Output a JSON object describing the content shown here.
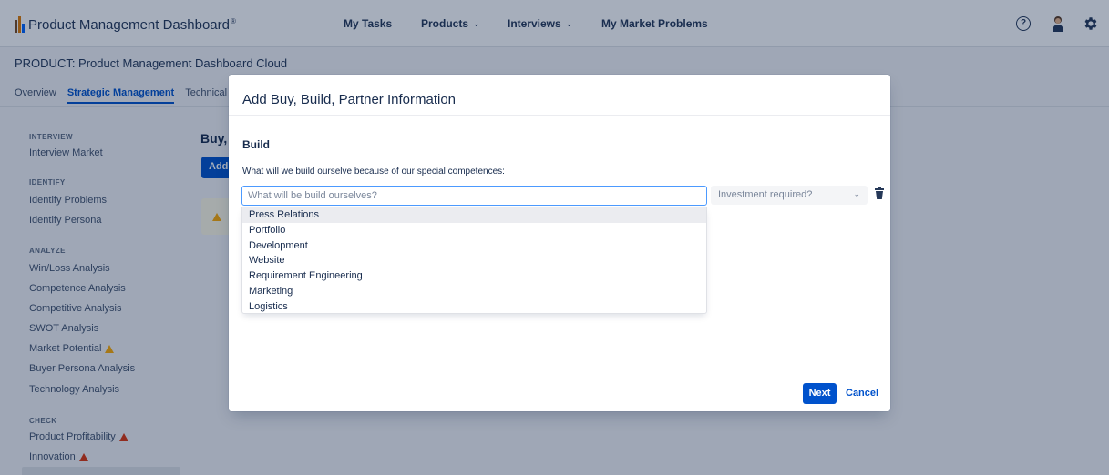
{
  "header": {
    "app_title": "Product Management Dashboard",
    "registered_mark": "®",
    "nav": [
      {
        "label": "My Tasks",
        "has_dropdown": false
      },
      {
        "label": "Products",
        "has_dropdown": true
      },
      {
        "label": "Interviews",
        "has_dropdown": true
      },
      {
        "label": "My Market Problems",
        "has_dropdown": false
      }
    ],
    "help_glyph": "?",
    "icons": [
      "help-icon",
      "user-avatar-icon",
      "settings-gear-icon"
    ]
  },
  "breadcrumb": "PRODUCT: Product Management Dashboard Cloud",
  "tabs": [
    "Overview",
    "Strategic Management",
    "Technical"
  ],
  "active_tab": "Strategic Management",
  "sidebar": {
    "sections": [
      {
        "title": "INTERVIEW",
        "items": [
          {
            "label": "Interview Market",
            "status": null
          }
        ]
      },
      {
        "title": "IDENTIFY",
        "items": [
          {
            "label": "Identify Problems",
            "status": null
          },
          {
            "label": "Identify Persona",
            "status": null
          }
        ]
      },
      {
        "title": "ANALYZE",
        "items": [
          {
            "label": "Win/Loss Analysis",
            "status": null
          },
          {
            "label": "Competence Analysis",
            "status": null
          },
          {
            "label": "Competitive Analysis",
            "status": null
          },
          {
            "label": "SWOT Analysis",
            "status": null
          },
          {
            "label": "Market Potential",
            "status": "warning-yellow"
          },
          {
            "label": "Buyer Persona Analysis",
            "status": null
          },
          {
            "label": "Technology Analysis",
            "status": null
          }
        ]
      },
      {
        "title": "CHECK",
        "items": [
          {
            "label": "Product Profitability",
            "status": "warning-red"
          },
          {
            "label": "Innovation",
            "status": "warning-red"
          }
        ]
      }
    ]
  },
  "main": {
    "heading": "Buy, I",
    "add_label": "Add"
  },
  "modal": {
    "title": "Add Buy, Build, Partner Information",
    "section_title": "Build",
    "field_label": "What will we build ourselve because of our special competences:",
    "input": {
      "value": "",
      "placeholder": "What will be build ourselves?"
    },
    "select": {
      "value": "Investment required?"
    },
    "dropdown_options": [
      "Press Relations",
      "Portfolio",
      "Development",
      "Website",
      "Requirement Engineering",
      "Marketing",
      "Logistics"
    ],
    "hovered_option": "Press Relations",
    "next_label": "Next",
    "cancel_label": "Cancel"
  },
  "colors": {
    "primary": "#0052cc",
    "warning_yellow": "#ffab00",
    "warning_red": "#de350b",
    "overlay": "rgba(9,30,66,0.36)"
  }
}
